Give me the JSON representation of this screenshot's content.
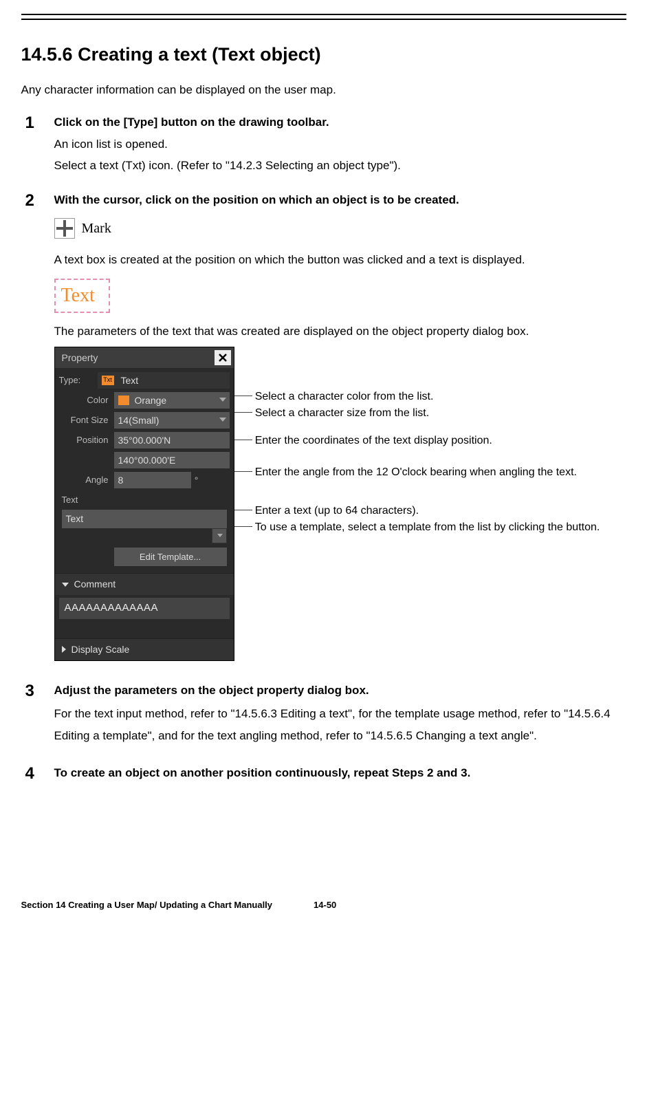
{
  "heading": "14.5.6   Creating a text (Text object)",
  "intro": "Any character information can be displayed on the user map.",
  "steps": [
    {
      "num": "1",
      "title": "Click on the [Type] button on the drawing toolbar.",
      "body1": "An icon list is opened.",
      "body2": "Select a text (Txt) icon. (Refer to \"14.2.3 Selecting an object type\")."
    },
    {
      "num": "2",
      "title": "With the cursor, click on the position on which an object is to be created.",
      "mark_label": "Mark",
      "after_mark": "A text box is created at the position on which the button was clicked and a text is displayed.",
      "textbox_label": "Text",
      "after_textbox": "The parameters of the text that was created are displayed on the object property dialog box."
    },
    {
      "num": "3",
      "title": "Adjust the parameters on the object property dialog box.",
      "body1": "For the text input method, refer to \"14.5.6.3 Editing a text\", for the template usage method, refer to \"14.5.6.4 Editing a template\", and for the text angling method, refer to \"14.5.6.5 Changing a text angle\"."
    },
    {
      "num": "4",
      "title": "To create an object on another position continuously, repeat Steps 2 and 3."
    }
  ],
  "dialog": {
    "title": "Property",
    "type_label": "Type:",
    "type_value": "Text",
    "txt_icon": "Txt",
    "color_label": "Color",
    "color_value": "Orange",
    "fontsize_label": "Font Size",
    "fontsize_value": "14(Small)",
    "position_label": "Position",
    "position_lat": "35°00.000'N",
    "position_lon": "140°00.000'E",
    "angle_label": "Angle",
    "angle_value": "8",
    "angle_unit": "°",
    "text_section": "Text",
    "text_value": "Text",
    "edit_template": "Edit Template...",
    "comment_section": "Comment",
    "comment_value": "AAAAAAAAAAAAA",
    "display_scale_section": "Display Scale"
  },
  "annotations": {
    "color": "Select a character color from the list.",
    "size": "Select a character size from the list.",
    "pos": "Enter the coordinates of the text display position.",
    "angle": "Enter the angle from the 12 O'clock bearing when angling the text.",
    "text": "Enter a text (up to 64 characters).",
    "template": "To use a template, select a template from the list by clicking the button."
  },
  "footer": {
    "section": "Section 14    Creating a User Map/ Updating a Chart Manually",
    "page": "14-50"
  }
}
